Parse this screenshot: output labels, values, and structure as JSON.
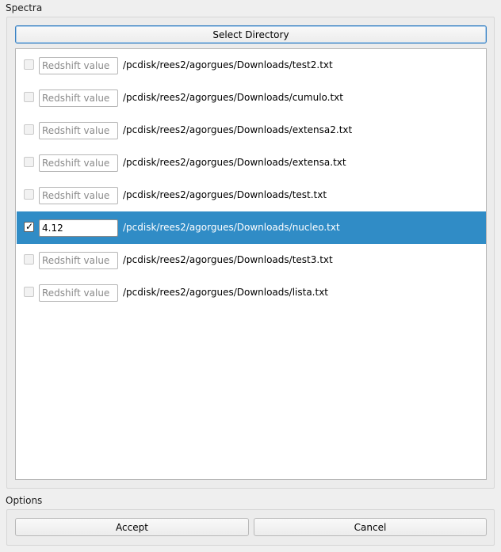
{
  "spectra": {
    "title": "Spectra",
    "select_directory_label": "Select Directory",
    "files": [
      {
        "checked": false,
        "redshift": "",
        "placeholder": "Redshift value",
        "path": "/pcdisk/rees2/agorgues/Downloads/test2.txt",
        "selected": false
      },
      {
        "checked": false,
        "redshift": "",
        "placeholder": "Redshift value",
        "path": "/pcdisk/rees2/agorgues/Downloads/cumulo.txt",
        "selected": false
      },
      {
        "checked": false,
        "redshift": "",
        "placeholder": "Redshift value",
        "path": "/pcdisk/rees2/agorgues/Downloads/extensa2.txt",
        "selected": false
      },
      {
        "checked": false,
        "redshift": "",
        "placeholder": "Redshift value",
        "path": "/pcdisk/rees2/agorgues/Downloads/extensa.txt",
        "selected": false
      },
      {
        "checked": false,
        "redshift": "",
        "placeholder": "Redshift value",
        "path": "/pcdisk/rees2/agorgues/Downloads/test.txt",
        "selected": false
      },
      {
        "checked": true,
        "redshift": "4.12",
        "placeholder": "Redshift value",
        "path": "/pcdisk/rees2/agorgues/Downloads/nucleo.txt",
        "selected": true
      },
      {
        "checked": false,
        "redshift": "",
        "placeholder": "Redshift value",
        "path": "/pcdisk/rees2/agorgues/Downloads/test3.txt",
        "selected": false
      },
      {
        "checked": false,
        "redshift": "",
        "placeholder": "Redshift value",
        "path": "/pcdisk/rees2/agorgues/Downloads/lista.txt",
        "selected": false
      }
    ]
  },
  "options": {
    "title": "Options",
    "accept_label": "Accept",
    "cancel_label": "Cancel"
  },
  "colors": {
    "selection": "#308cc6",
    "window_bg": "#efefef",
    "focus_border": "#3a82c3"
  },
  "icons": {
    "check_glyph": "✓"
  }
}
